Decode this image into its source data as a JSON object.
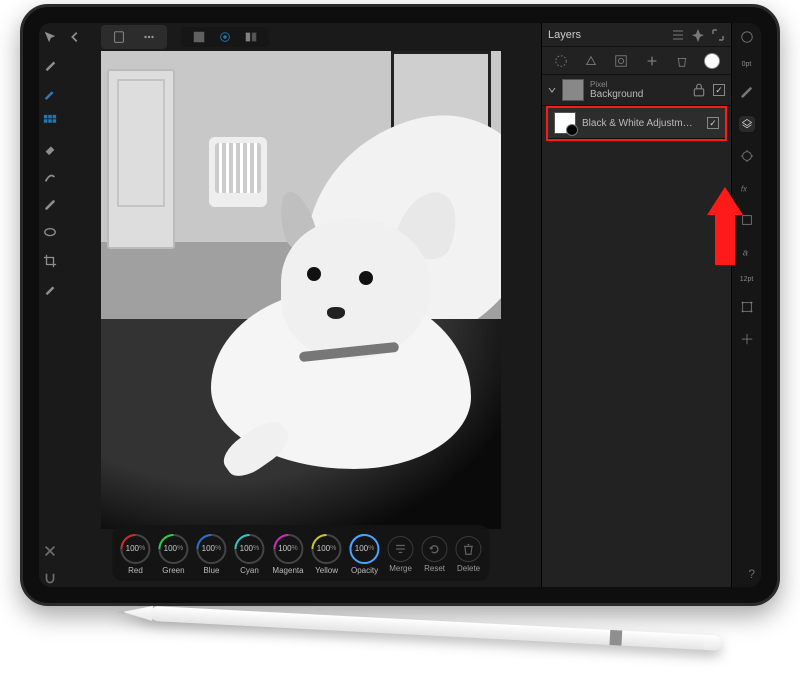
{
  "panel": {
    "title": "Layers",
    "layers": {
      "bg": {
        "kind": "Pixel",
        "name": "Background",
        "locked": true,
        "visible": true
      },
      "bw": {
        "name": "Black & White Adjustm…",
        "visible": true
      }
    }
  },
  "bw_controls": {
    "dials": [
      {
        "label": "Red",
        "value": "100",
        "unit": "%",
        "arc": "#cc2b2b"
      },
      {
        "label": "Green",
        "value": "100",
        "unit": "%",
        "arc": "#2bcc4a"
      },
      {
        "label": "Blue",
        "value": "100",
        "unit": "%",
        "arc": "#2b6fcc"
      },
      {
        "label": "Cyan",
        "value": "100",
        "unit": "%",
        "arc": "#2bc7cc"
      },
      {
        "label": "Magenta",
        "value": "100",
        "unit": "%",
        "arc": "#cc2bb8"
      },
      {
        "label": "Yellow",
        "value": "100",
        "unit": "%",
        "arc": "#ccc52b"
      },
      {
        "label": "Opacity",
        "value": "100",
        "unit": "%",
        "arc": "#4aa3ff"
      }
    ],
    "buttons": [
      {
        "label": "Merge",
        "icon": "merge"
      },
      {
        "label": "Reset",
        "icon": "reset"
      },
      {
        "label": "Delete",
        "icon": "delete"
      }
    ]
  },
  "right_tools": {
    "labels": {
      "opt": "0pt",
      "twelvept": "12pt"
    }
  },
  "misc": {
    "help": "?"
  }
}
